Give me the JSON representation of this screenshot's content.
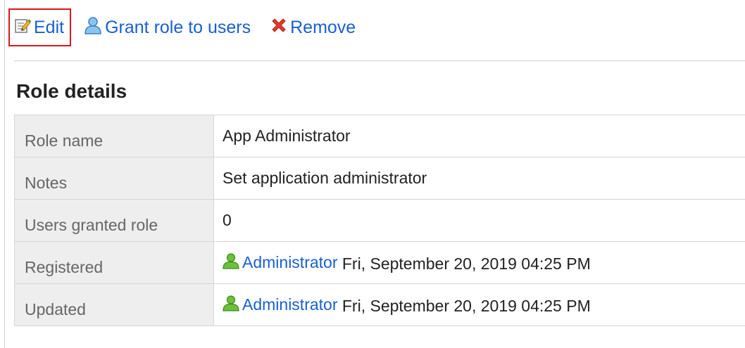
{
  "toolbar": {
    "edit_label": "Edit",
    "grant_label": "Grant role to users",
    "remove_label": "Remove"
  },
  "section": {
    "title": "Role details"
  },
  "details": {
    "role_name": {
      "label": "Role name",
      "value": "App Administrator"
    },
    "notes": {
      "label": "Notes",
      "value": "Set application administrator"
    },
    "users_granted": {
      "label": "Users granted role",
      "value": "0"
    },
    "registered": {
      "label": "Registered",
      "user": "Administrator",
      "datetime": "Fri, September 20, 2019 04:25 PM"
    },
    "updated": {
      "label": "Updated",
      "user": "Administrator",
      "datetime": "Fri, September 20, 2019 04:25 PM"
    }
  },
  "icons": {
    "edit": "edit-icon",
    "grant": "user-icon",
    "remove": "remove-icon",
    "user": "user-green-icon"
  },
  "colors": {
    "link": "#1a5fd1",
    "highlight": "#e0141b",
    "label_bg": "#eeeeee",
    "user_icon_green": "#5bb12f",
    "grant_icon_blue": "#4a9be0",
    "remove_icon_red": "#e2392a"
  }
}
